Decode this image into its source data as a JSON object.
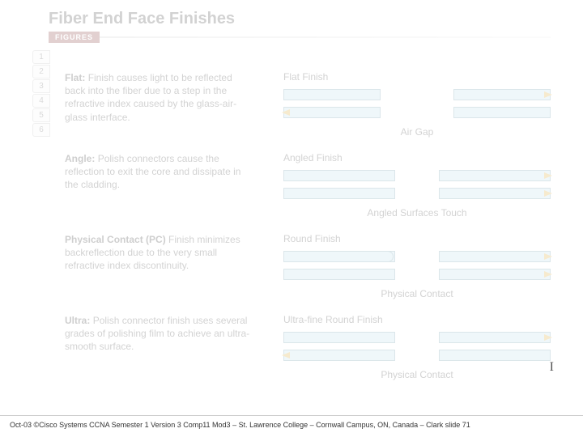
{
  "title": "Fiber End Face Finishes",
  "figures_label": "FIGURES",
  "tabs": [
    "1",
    "2",
    "3",
    "4",
    "5",
    "6"
  ],
  "sections": [
    {
      "term": "Flat:",
      "body": "Finish causes light to be reflected back into the fiber due to a step in the refractive index caused by the glass-air-glass interface.",
      "dia_title": "Flat Finish",
      "caption": "Air Gap"
    },
    {
      "term": "Angle:",
      "body": "Polish connectors cause the reflection to exit the core and dissipate in the cladding.",
      "dia_title": "Angled Finish",
      "caption": "Angled Surfaces Touch"
    },
    {
      "term": "Physical Contact (PC)",
      "body": "Finish minimizes backreflection due to the very small refractive index discontinuity.",
      "dia_title": "Round Finish",
      "caption": "Physical Contact"
    },
    {
      "term": "Ultra:",
      "body": "Polish connector finish uses several grades of polishing film to achieve an ultra-smooth surface.",
      "dia_title": "Ultra-fine Round Finish",
      "caption": "Physical Contact"
    }
  ],
  "footer": "Oct-03 ©Cisco Systems CCNA Semester 1 Version 3 Comp11 Mod3 – St. Lawrence College – Cornwall Campus, ON, Canada – Clark slide 71"
}
